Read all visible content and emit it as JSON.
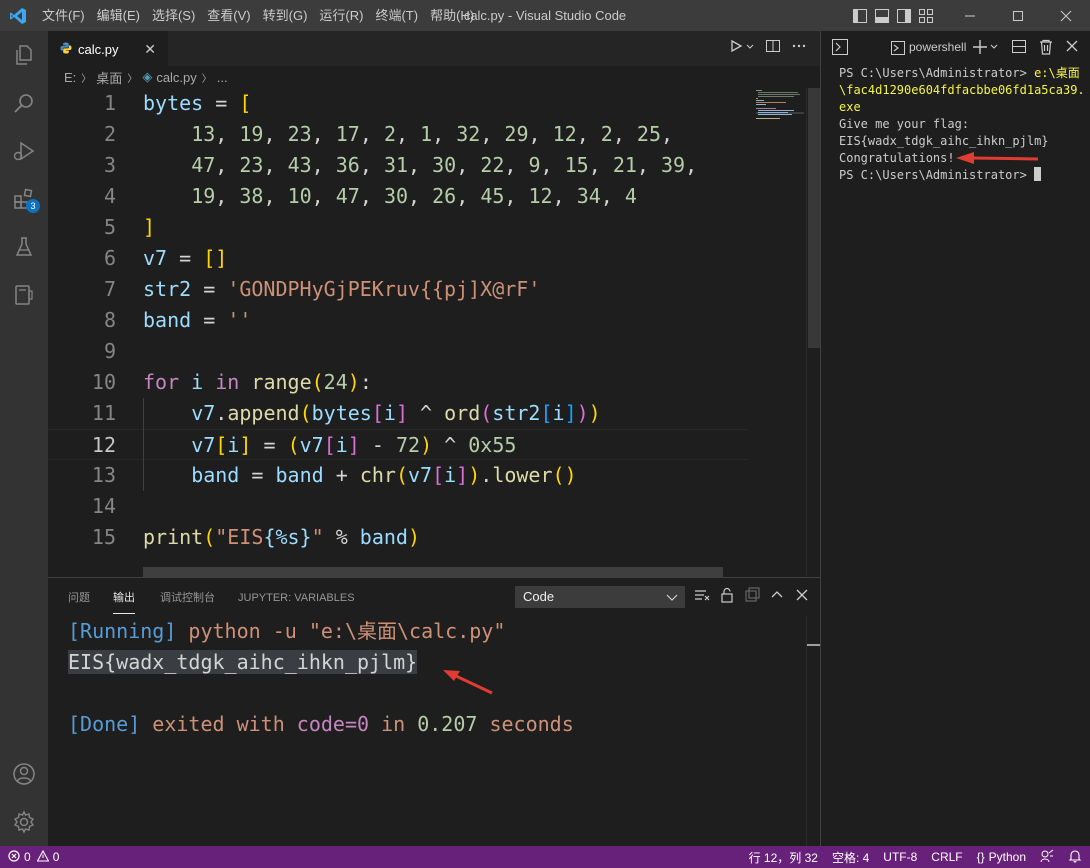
{
  "titlebar": {
    "title": "calc.py - Visual Studio Code",
    "menu": [
      "文件(F)",
      "编辑(E)",
      "选择(S)",
      "查看(V)",
      "转到(G)",
      "运行(R)",
      "终端(T)",
      "帮助(H)"
    ]
  },
  "activity": {
    "extensions_badge": "3"
  },
  "editor": {
    "tab_label": "calc.py",
    "breadcrumb": {
      "drive": "E:",
      "folder": "桌面",
      "file": "calc.py",
      "more": "..."
    },
    "current_line": 12,
    "lines": [
      "bytes = [",
      "    13, 19, 23, 17, 2, 1, 32, 29, 12, 2, 25,",
      "    47, 23, 43, 36, 31, 30, 22, 9, 15, 21, 39,",
      "    19, 38, 10, 47, 30, 26, 45, 12, 34, 4",
      "]",
      "v7 = []",
      "str2 = 'GONDPHyGjPEKruv{{pj]X@rF'",
      "band = ''",
      "",
      "for i in range(24):",
      "    v7.append(bytes[i] ^ ord(str2[i]))",
      "    v7[i] = (v7[i] - 72) ^ 0x55",
      "    band = band + chr(v7[i]).lower()",
      "",
      "print(\"EIS{%s}\" % band)"
    ]
  },
  "panel": {
    "tabs": [
      "问题",
      "输出",
      "调试控制台",
      "JUPYTER: VARIABLES"
    ],
    "active_tab": "输出",
    "channel": "Code",
    "output": {
      "running_tag": "[Running]",
      "running_cmd": " python -u \"e:\\桌面\\calc.py\"",
      "result": "EIS{wadx_tdgk_aihc_ihkn_pjlm}",
      "done_tag": "[Done]",
      "done_text": " exited with ",
      "done_code": "code=0",
      "done_in": " in ",
      "done_time": "0.207",
      "done_seconds": " seconds"
    }
  },
  "terminal": {
    "shell": "powershell",
    "lines": [
      {
        "prompt": "PS C:\\Users\\Administrator> ",
        "cmd": "e:\\桌面"
      },
      {
        "prompt": "",
        "cmd": "\\fac4d1290e604fdfacbbe06fd1a5ca39."
      },
      {
        "prompt": "",
        "cmd": "exe"
      },
      {
        "prompt": "Give me your flag:",
        "cmd": ""
      },
      {
        "prompt": "EIS{wadx_tdgk_aihc_ihkn_pjlm}",
        "cmd": ""
      },
      {
        "prompt": "Congratulations!",
        "cmd": ""
      },
      {
        "prompt": "PS C:\\Users\\Administrator> ",
        "cmd": ""
      }
    ]
  },
  "status": {
    "errors": "0",
    "warnings": "0",
    "position": "行 12，列 32",
    "spaces": "空格: 4",
    "encoding": "UTF-8",
    "eol": "CRLF",
    "language": "Python"
  },
  "colors": {
    "statusbar": "#68217a",
    "accent": "#0e70c0",
    "arrow": "#e03c31"
  }
}
